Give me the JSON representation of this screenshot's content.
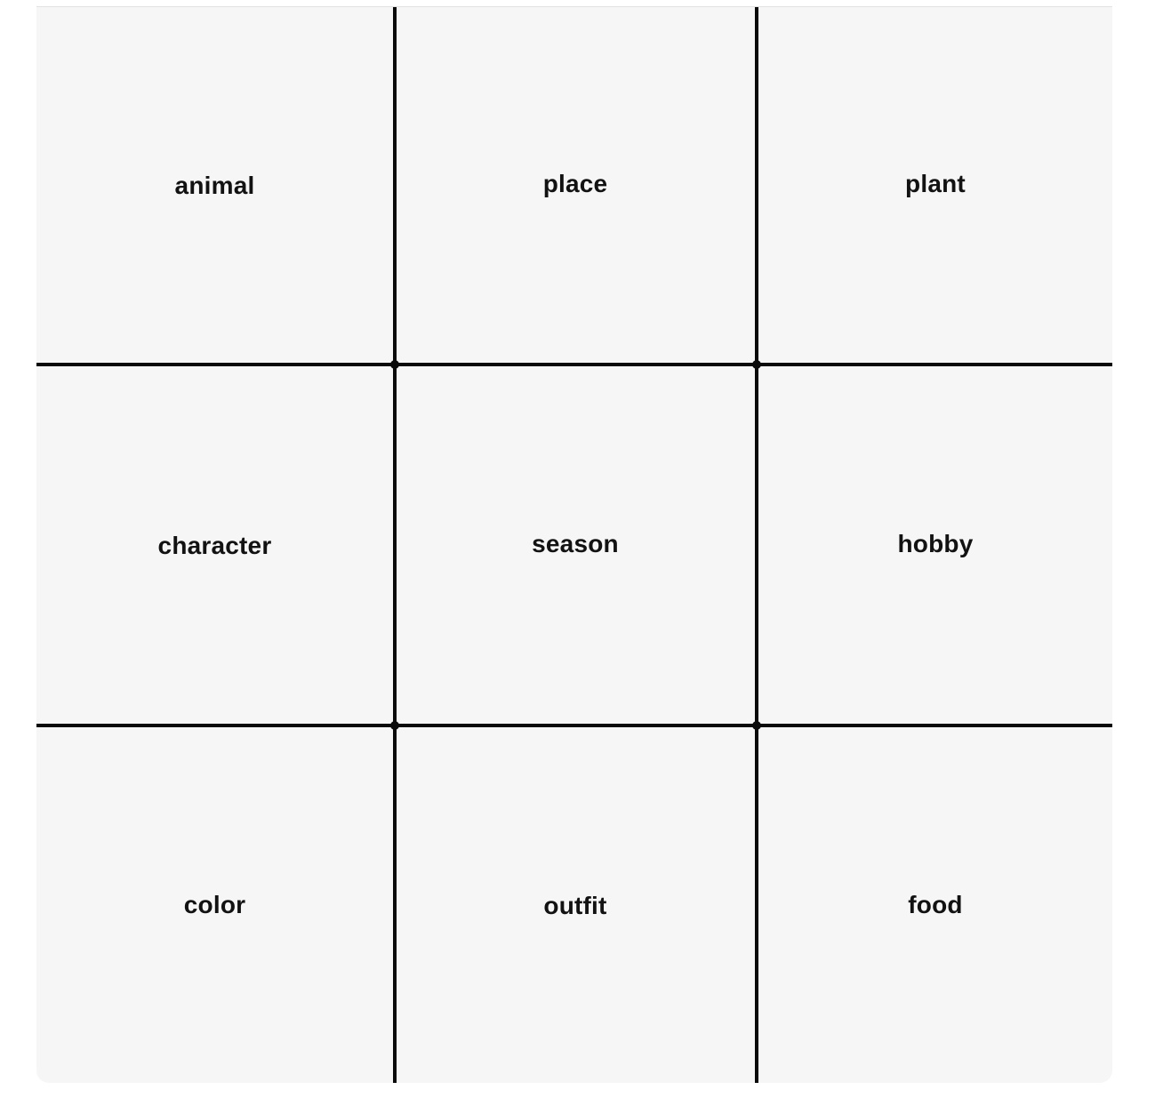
{
  "grid": {
    "cells": [
      {
        "label": "animal"
      },
      {
        "label": "place"
      },
      {
        "label": "plant"
      },
      {
        "label": "character"
      },
      {
        "label": "season"
      },
      {
        "label": "hobby"
      },
      {
        "label": "color"
      },
      {
        "label": "outfit"
      },
      {
        "label": "food"
      }
    ]
  },
  "colors": {
    "background": "#f6f6f6",
    "lines": "#0a0a0a",
    "text": "#121212"
  }
}
